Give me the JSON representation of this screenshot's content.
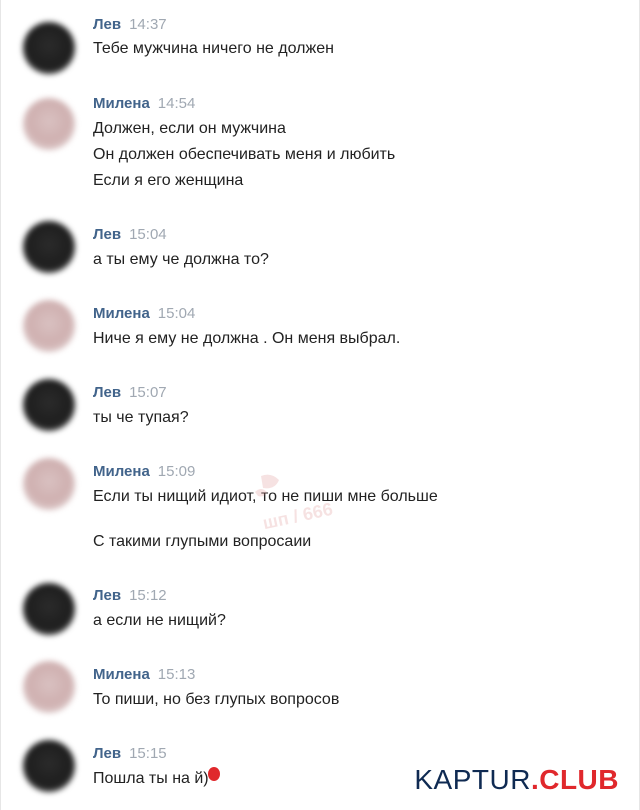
{
  "messages": [
    {
      "sender": "Лев",
      "time": "14:37",
      "lines": [
        "Тебе мужчина ничего не должен"
      ]
    },
    {
      "sender": "Милена",
      "time": "14:54",
      "lines": [
        "Должен, если он мужчина",
        "Он должен обеспечивать меня и любить",
        "Если я его женщина"
      ]
    },
    {
      "sender": "Лев",
      "time": "15:04",
      "lines": [
        "а ты ему че должна то?"
      ]
    },
    {
      "sender": "Милена",
      "time": "15:04",
      "lines": [
        "Ниче я ему не должна . Он меня выбрал."
      ]
    },
    {
      "sender": "Лев",
      "time": "15:07",
      "lines": [
        "ты че тупая?"
      ]
    },
    {
      "sender": "Милена",
      "time": "15:09",
      "lines": [
        "Если ты нищий идиот, то не пиши мне больше",
        "С такими глупыми вопросаии"
      ]
    },
    {
      "sender": "Лев",
      "time": "15:12",
      "lines": [
        "а если не нищий?"
      ]
    },
    {
      "sender": "Милена",
      "time": "15:13",
      "lines": [
        "То пиши, но без глупых вопросов"
      ]
    },
    {
      "sender": "Лев",
      "time": "15:15",
      "lines": [
        "Пошла ты на   й)"
      ]
    }
  ],
  "watermark": {
    "text": "шп / 666"
  },
  "brand": {
    "part1": "KAPTUR",
    "part2": ".CLUB",
    "color_dark": "#0f2a52",
    "color_red": "#e0282c"
  },
  "colors": {
    "name": "#42648b",
    "time": "#a0a8b2",
    "text": "#222222"
  }
}
